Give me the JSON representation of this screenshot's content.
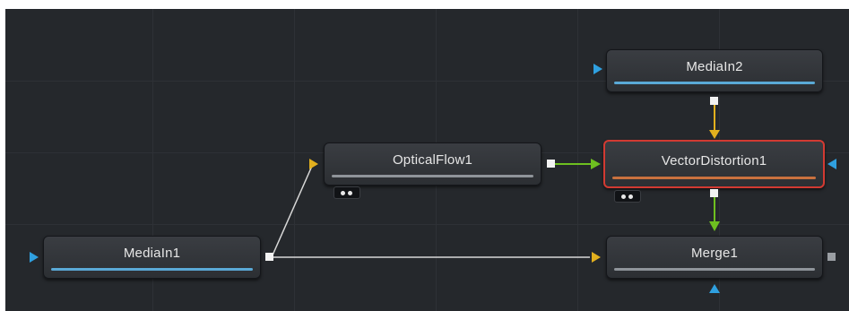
{
  "nodes": {
    "mediain1": {
      "title": "MediaIn1"
    },
    "mediain2": {
      "title": "MediaIn2"
    },
    "opticalflow1": {
      "title": "OpticalFlow1"
    },
    "vectordistortion1": {
      "title": "VectorDistortion1",
      "selected": true
    },
    "merge1": {
      "title": "Merge1"
    }
  },
  "colors": {
    "canvas_bg": "#25282c",
    "mask_input": "#2fa0e0",
    "background_input": "#e2b01e",
    "foreground_input": "#6ec020",
    "selection": "#d23a32",
    "media_bar": "#5aa9d6"
  },
  "connections": [
    {
      "from": "MediaIn1",
      "to": "OpticalFlow1"
    },
    {
      "from": "MediaIn1",
      "to": "Merge1"
    },
    {
      "from": "MediaIn2",
      "to": "VectorDistortion1"
    },
    {
      "from": "OpticalFlow1",
      "to": "VectorDistortion1"
    },
    {
      "from": "VectorDistortion1",
      "to": "Merge1"
    }
  ]
}
